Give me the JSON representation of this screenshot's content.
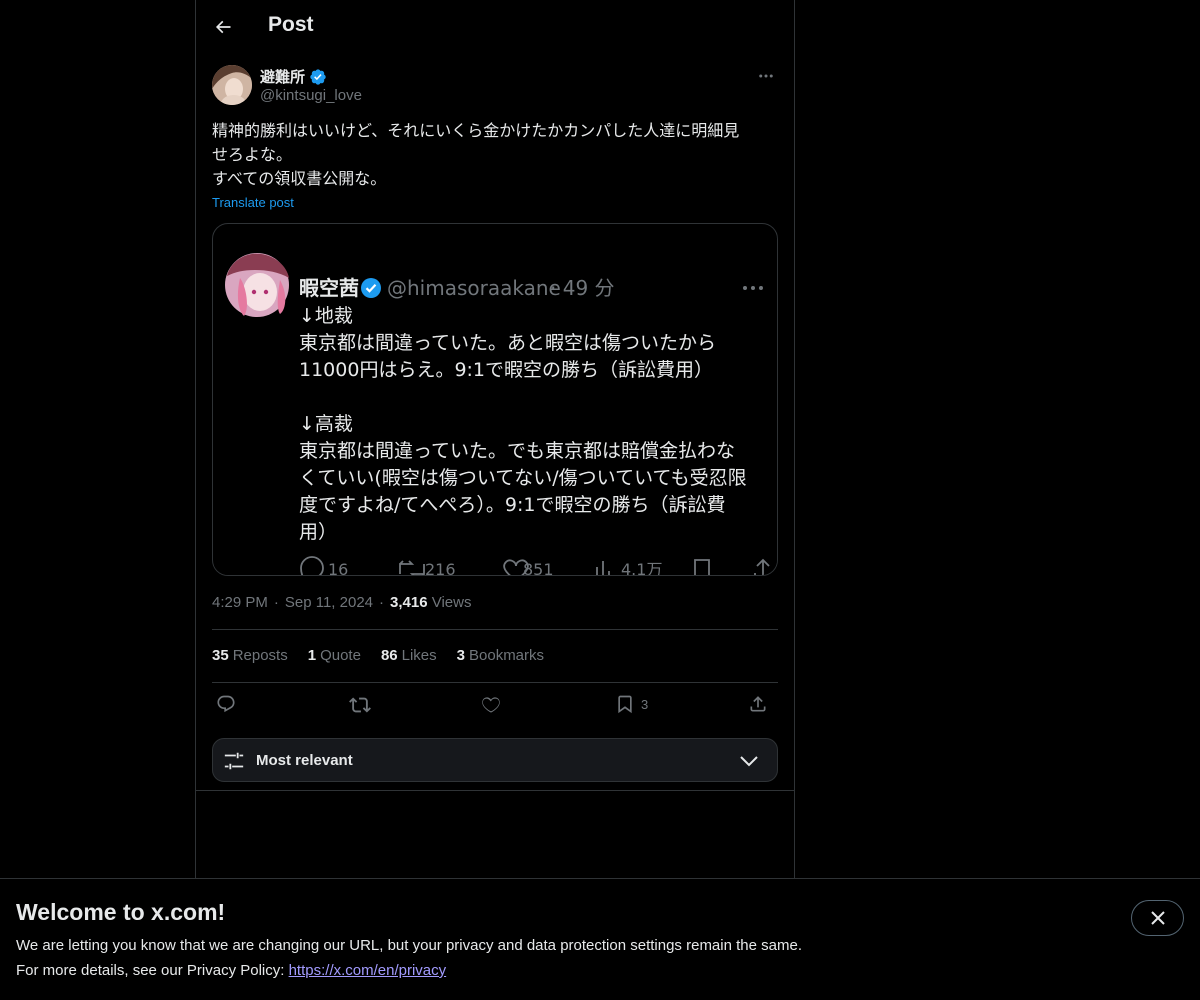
{
  "header": {
    "title": "Post"
  },
  "author": {
    "display_name": "避難所",
    "handle": "@kintsugi_love"
  },
  "post": {
    "text": "精神的勝利はいいけど、それにいくら金かけたかカンパした人達に明細見\nせろよな。\nすべての領収書公開な。",
    "translate_label": "Translate post"
  },
  "embedded": {
    "display_name": "暇空茜",
    "handle": "@himasoraakane",
    "time": "· 49 分",
    "lines": [
      "↓地裁",
      "東京都は間違っていた。あと暇空は傷ついたから",
      "11000円はらえ。9:1で暇空の勝ち（訴訟費用）",
      "",
      "↓高裁",
      "東京都は間違っていた。でも東京都は賠償金払わな",
      "くていい(暇空は傷ついてない/傷ついていても受忍限",
      "度ですよね/てへぺろ）。9:1で暇空の勝ち（訴訟費",
      "用）"
    ],
    "replies": "16",
    "reposts": "216",
    "likes": "851",
    "views": "4.1万"
  },
  "meta": {
    "time": "4:29 PM",
    "sep": "·",
    "date": "Sep 11, 2024",
    "views_count": "3,416",
    "views_label": "Views"
  },
  "stats": [
    {
      "num": "35",
      "label": "Reposts"
    },
    {
      "num": "1",
      "label": "Quote"
    },
    {
      "num": "86",
      "label": "Likes"
    },
    {
      "num": "3",
      "label": "Bookmarks"
    }
  ],
  "actions": {
    "bookmark_count": "3"
  },
  "sort": {
    "label": "Most relevant"
  },
  "banner": {
    "title": "Welcome to x.com!",
    "line1": "We are letting you know that we are changing our URL, but your privacy and data protection settings remain the same.",
    "line2_prefix": "For more details, see our Privacy Policy: ",
    "link": "https://x.com/en/privacy"
  },
  "colors": {
    "accent": "#1d9bf0",
    "muted": "#71767b",
    "text": "#e7e9ea",
    "border": "#2f3336"
  }
}
